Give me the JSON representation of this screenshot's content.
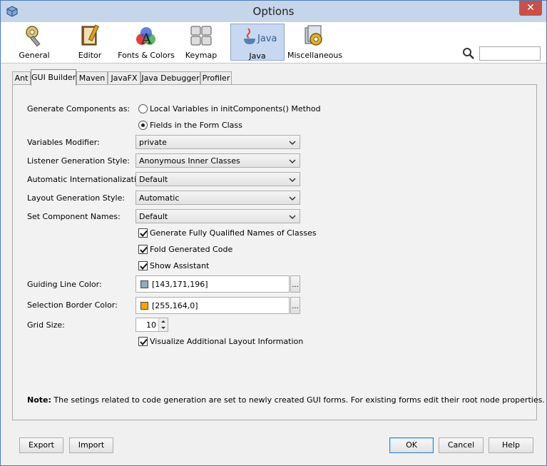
{
  "window": {
    "title": "Options"
  },
  "categories": [
    {
      "id": "general",
      "label": "General",
      "icon": "gear-wrench-icon"
    },
    {
      "id": "editor",
      "label": "Editor",
      "icon": "editor-book-icon"
    },
    {
      "id": "fonts",
      "label": "Fonts & Colors",
      "icon": "fonts-colors-icon"
    },
    {
      "id": "keymap",
      "label": "Keymap",
      "icon": "keyboard-icon"
    },
    {
      "id": "java",
      "label": "Java",
      "icon": "java-cup-icon",
      "selected": true
    },
    {
      "id": "misc",
      "label": "Miscellaneous",
      "icon": "misc-gear-icon"
    }
  ],
  "search": {
    "placeholder": "",
    "value": ""
  },
  "tabs": [
    {
      "label": "Ant"
    },
    {
      "label": "GUI Builder",
      "active": true
    },
    {
      "label": "Maven"
    },
    {
      "label": "JavaFX"
    },
    {
      "label": "Java Debugger"
    },
    {
      "label": "Profiler"
    }
  ],
  "form": {
    "generate_components": {
      "label": "Generate Components as:",
      "options": [
        "Local Variables in initComponents() Method",
        "Fields in the Form Class"
      ],
      "selected_index": 1
    },
    "variables_modifier": {
      "label": "Variables Modifier:",
      "value": "private"
    },
    "listener_style": {
      "label": "Listener Generation Style:",
      "value": "Anonymous Inner Classes"
    },
    "auto_i18n": {
      "label": "Automatic Internationalization:",
      "value": "Default"
    },
    "layout_style": {
      "label": "Layout Generation Style:",
      "value": "Automatic"
    },
    "component_names": {
      "label": "Set Component Names:",
      "value": "Default"
    },
    "checks": [
      {
        "label": "Generate Fully Qualified Names of Classes",
        "checked": true
      },
      {
        "label": "Fold Generated Code",
        "checked": true
      },
      {
        "label": "Show Assistant",
        "checked": true
      }
    ],
    "guiding_line_color": {
      "label": "Guiding Line Color:",
      "value": "[143,171,196]",
      "swatch": "#8fabc4"
    },
    "selection_border_color": {
      "label": "Selection Border Color:",
      "value": "[255,164,0]",
      "swatch": "#ffa400"
    },
    "grid_size": {
      "label": "Grid Size:",
      "value": "10"
    },
    "visualize_layout": {
      "label": "Visualize Additional Layout Information",
      "checked": true
    },
    "ellipsis": "...",
    "note_bold": "Note:",
    "note_text": " The setings related to code generation are set to newly created GUI forms. For existing forms edit their root node properties."
  },
  "buttons": {
    "export": "Export",
    "import": "Import",
    "ok": "OK",
    "cancel": "Cancel",
    "help": "Help"
  },
  "colors": {
    "title_bar": "#c5d5ea",
    "selected_category": "#c8d8f0",
    "close": "#c7504a"
  }
}
